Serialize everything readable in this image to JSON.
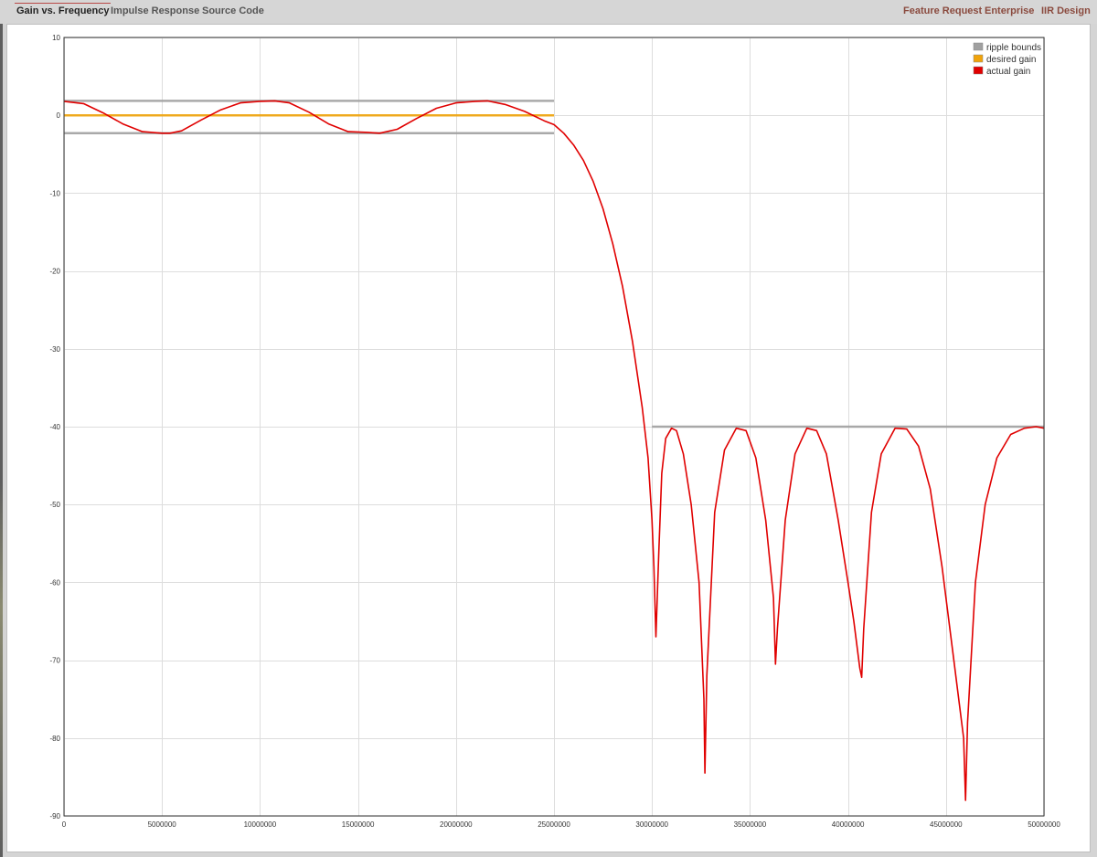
{
  "nav": {
    "tabs": [
      {
        "label": "Gain vs. Frequency",
        "active": true
      },
      {
        "label": "Impulse Response",
        "active": false
      },
      {
        "label": "Source Code",
        "active": false
      }
    ],
    "links": [
      "Feature Request",
      "Enterprise",
      "IIR Design"
    ]
  },
  "colors": {
    "ripple_bounds": "#a0a0a0",
    "desired_gain": "#f0a30a",
    "actual_gain": "#e00000",
    "grid": "#dddddd",
    "link": "#8a4a3e"
  },
  "chart_data": {
    "type": "line",
    "title": "",
    "xlabel": "",
    "ylabel": "",
    "xlim": [
      0,
      50000000
    ],
    "ylim": [
      -90,
      10
    ],
    "x_ticks": [
      0,
      5000000,
      10000000,
      15000000,
      20000000,
      25000000,
      30000000,
      35000000,
      40000000,
      45000000,
      50000000
    ],
    "x_tick_labels": [
      "0",
      "5000000",
      "10000000",
      "15000000",
      "20000000",
      "25000000",
      "30000000",
      "35000000",
      "40000000",
      "45000000",
      "50000000"
    ],
    "y_ticks": [
      10,
      0,
      -10,
      -20,
      -30,
      -40,
      -50,
      -60,
      -70,
      -80,
      -90
    ],
    "y_tick_labels": [
      "10",
      "0",
      "-10",
      "-20",
      "-30",
      "-40",
      "-50",
      "-60",
      "-70",
      "-80",
      "-90"
    ],
    "grid": true,
    "legend_position": "top-right",
    "series": [
      {
        "name": "ripple bounds",
        "color": "#a0a0a0",
        "segments": [
          {
            "x": [
              0,
              25000000
            ],
            "y": [
              1.85,
              1.85
            ]
          },
          {
            "x": [
              0,
              25000000
            ],
            "y": [
              -2.3,
              -2.3
            ]
          },
          {
            "x": [
              30000000,
              50000000
            ],
            "y": [
              -40.0,
              -40.0
            ]
          }
        ]
      },
      {
        "name": "desired gain",
        "color": "#f0a30a",
        "segments": [
          {
            "x": [
              0,
              25000000
            ],
            "y": [
              0,
              0
            ]
          }
        ]
      },
      {
        "name": "actual gain",
        "color": "#e00000",
        "x": [
          0,
          1000000,
          2000000,
          3000000,
          4000000,
          5000000,
          5400000,
          6000000,
          7000000,
          8000000,
          9000000,
          10000000,
          10750000,
          11500000,
          12500000,
          13500000,
          14500000,
          15500000,
          16100000,
          17000000,
          18000000,
          19000000,
          20000000,
          21000000,
          21600000,
          22500000,
          23500000,
          24500000,
          25000000,
          25500000,
          26000000,
          26500000,
          27000000,
          27500000,
          28000000,
          28500000,
          29000000,
          29500000,
          29800000,
          30000000,
          30100000,
          30200000,
          30350000,
          30500000,
          30700000,
          31000000,
          31250000,
          31600000,
          32000000,
          32400000,
          32650000,
          32700000,
          32800000,
          33200000,
          33700000,
          34300000,
          34800000,
          35300000,
          35800000,
          36200000,
          36300000,
          36400000,
          36800000,
          37300000,
          37900000,
          38400000,
          38900000,
          39500000,
          40000000,
          40300000,
          40600000,
          40700000,
          40800000,
          41200000,
          41700000,
          42400000,
          43000000,
          43600000,
          44200000,
          44800000,
          45400000,
          45900000,
          46000000,
          46100000,
          46500000,
          47000000,
          47600000,
          48300000,
          49000000,
          49600000,
          50000000
        ],
        "y": [
          1.8,
          1.5,
          0.3,
          -1.1,
          -2.1,
          -2.3,
          -2.3,
          -2.0,
          -0.6,
          0.7,
          1.6,
          1.8,
          1.85,
          1.6,
          0.4,
          -1.1,
          -2.1,
          -2.2,
          -2.3,
          -1.8,
          -0.4,
          0.9,
          1.6,
          1.8,
          1.85,
          1.4,
          0.5,
          -0.7,
          -1.2,
          -2.3,
          -3.8,
          -5.8,
          -8.5,
          -12.0,
          -16.5,
          -22.0,
          -29.0,
          -37.5,
          -44.0,
          -52.0,
          -58.0,
          -67.0,
          -56.0,
          -46.0,
          -41.5,
          -40.2,
          -40.5,
          -43.5,
          -50.0,
          -60.0,
          -75.0,
          -84.5,
          -72.0,
          -51.0,
          -43.0,
          -40.2,
          -40.5,
          -44.0,
          -52.0,
          -62.0,
          -70.5,
          -66.0,
          -52.0,
          -43.5,
          -40.2,
          -40.5,
          -43.5,
          -52.0,
          -60.0,
          -65.0,
          -71.0,
          -72.2,
          -66.0,
          -51.0,
          -43.5,
          -40.2,
          -40.3,
          -42.5,
          -48.0,
          -58.0,
          -70.0,
          -80.0,
          -88.0,
          -78.0,
          -60.0,
          -50.0,
          -44.0,
          -41.0,
          -40.2,
          -40.0,
          -40.2
        ]
      }
    ]
  }
}
